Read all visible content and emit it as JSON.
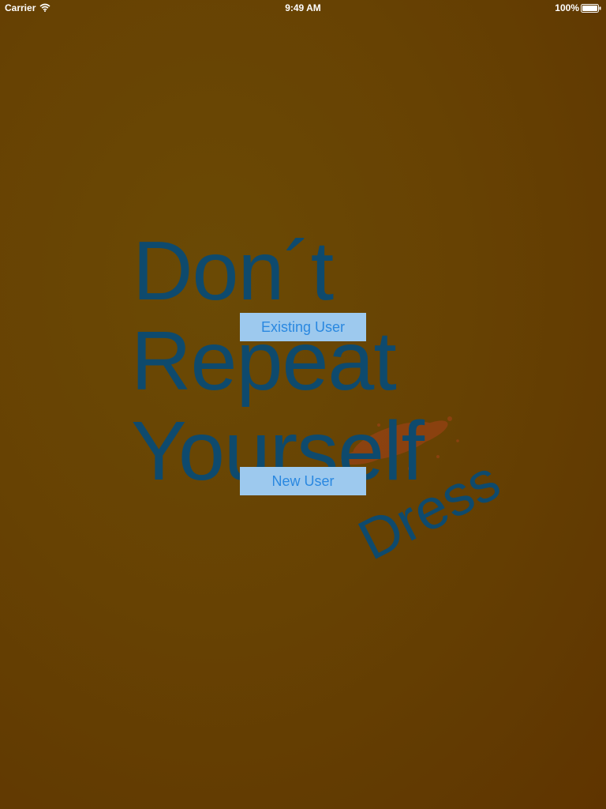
{
  "status_bar": {
    "carrier": "Carrier",
    "time": "9:49 AM",
    "battery_percent": "100%",
    "wifi_icon": "wifi-icon",
    "battery_icon": "battery-icon"
  },
  "logo": {
    "line1": "Don´t",
    "line2": "Repeat",
    "line3": "Yourself",
    "tag": "Dress",
    "text_color": "#0e4a6d",
    "splatter_color": "#a8411a"
  },
  "buttons": {
    "existing_user": "Existing User",
    "new_user": "New User",
    "background": "#9dc9ee",
    "text_color": "#2a88e0"
  },
  "colors": {
    "background_center": "#6b4a05",
    "background_edge": "#5f3400"
  }
}
